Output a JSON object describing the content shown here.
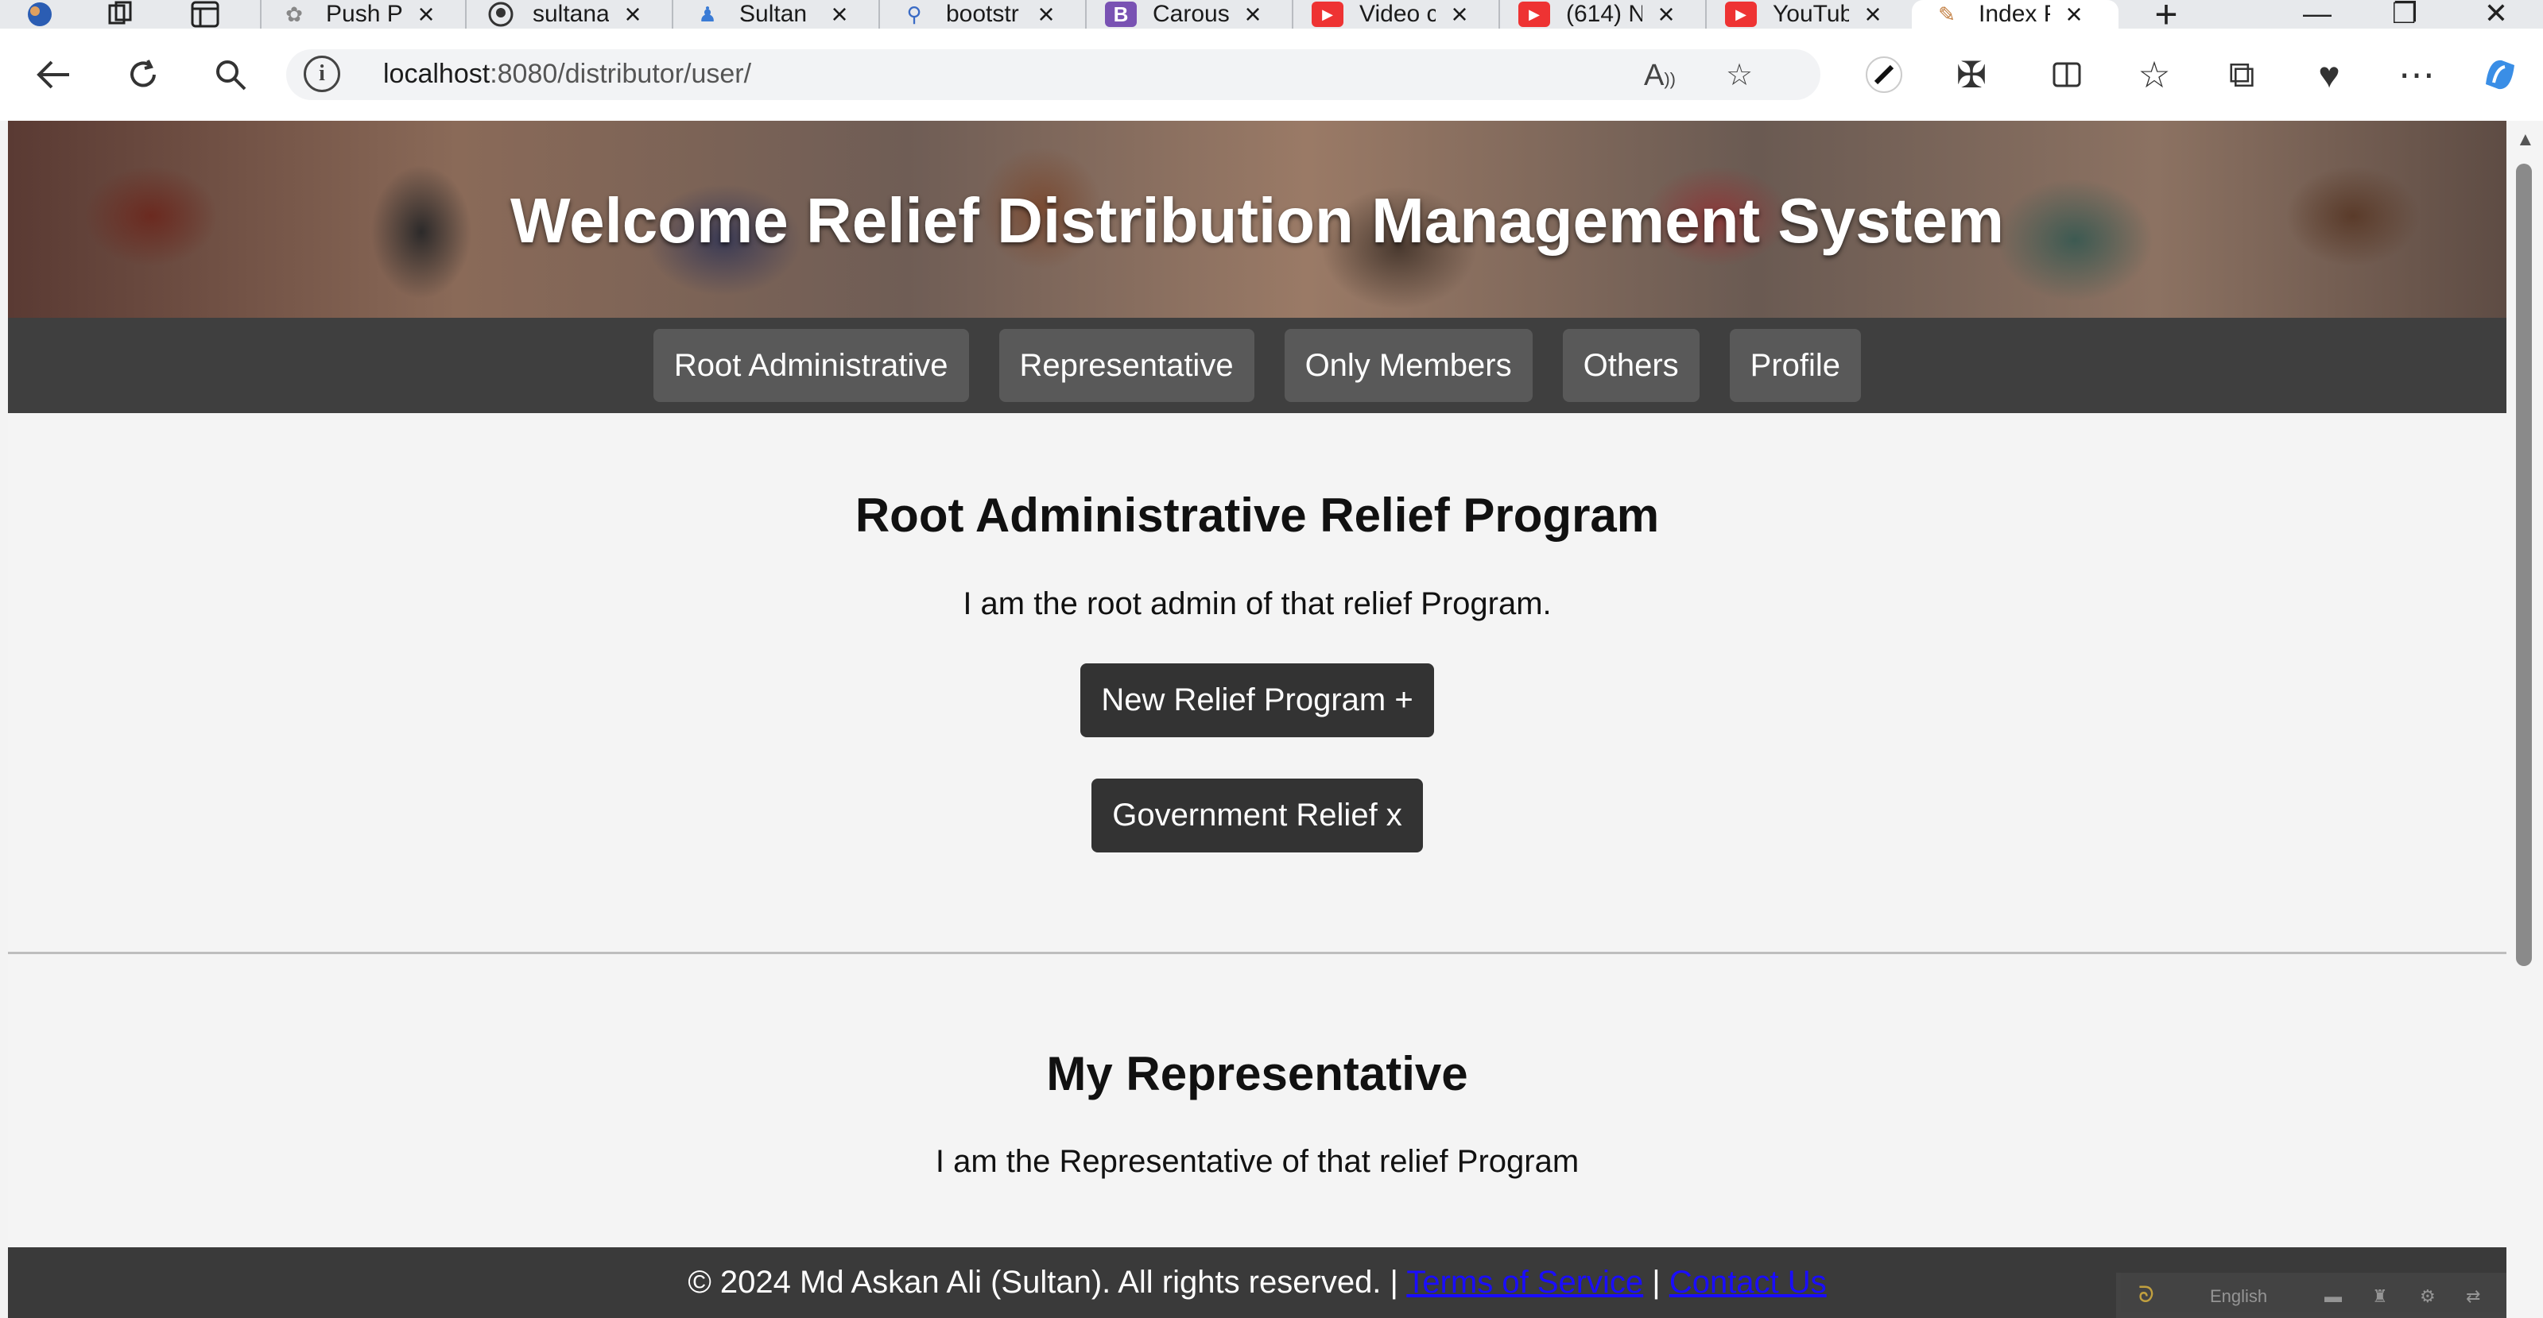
{
  "browser": {
    "tabs": [
      {
        "title": "Push Pr",
        "icon": "openai-icon"
      },
      {
        "title": "sultana",
        "icon": "github-icon"
      },
      {
        "title": "Sultan",
        "icon": "person-icon"
      },
      {
        "title": "bootstr",
        "icon": "search-icon"
      },
      {
        "title": "Carous",
        "icon": "bootstrap-icon"
      },
      {
        "title": "Video c",
        "icon": "youtube-icon"
      },
      {
        "title": "(614) N",
        "icon": "youtube-icon"
      },
      {
        "title": "YouTub",
        "icon": "youtube-icon"
      },
      {
        "title": "Index P",
        "icon": "page-icon",
        "active": true
      }
    ],
    "url_host": "localhost",
    "url_rest": ":8080/distributor/user/"
  },
  "page": {
    "hero_title": "Welcome Relief Distribution Management System",
    "nav": [
      "Root Administrative",
      "Representative",
      "Only Members",
      "Others",
      "Profile"
    ],
    "admin_section": {
      "title": "Root Administrative Relief Program",
      "text": "I am the root admin of that relief Program.",
      "new_button": "New Relief Program +",
      "gov_button": "Government Relief x"
    },
    "rep_section": {
      "title": "My Representative",
      "text": "I am the Representative of that relief Program"
    },
    "footer": {
      "text": "© 2024 Md Askan Ali (Sultan). All rights reserved. | ",
      "terms": "Terms of Service",
      "sep": " | ",
      "contact": "Contact Us"
    },
    "translate_widget": {
      "language": "English"
    }
  },
  "colors": {
    "nav_bg": "#3f3f3f",
    "nav_btn": "#595959",
    "button": "#333333",
    "footer_bg": "#3a3a3a",
    "link": "#1a0dff"
  }
}
